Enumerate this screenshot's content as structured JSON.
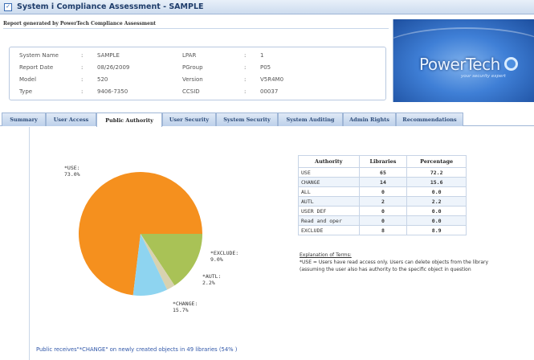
{
  "window": {
    "title": "System i Compliance Assessment - SAMPLE",
    "icon": "checkbox-icon"
  },
  "report_line": "Report generated by PowerTech Compliance Assessment",
  "info": {
    "system_name_label": "System Name",
    "system_name_value": "SAMPLE",
    "report_date_label": "Report Date",
    "report_date_value": "08/26/2009",
    "model_label": "Model",
    "model_value": "520",
    "type_label": "Type",
    "type_value": "9406-7350",
    "lpar_label": "LPAR",
    "lpar_value": "1",
    "pgroup_label": "PGroup",
    "pgroup_value": "P05",
    "version_label": "Version",
    "version_value": "V5R4M0",
    "ccsid_label": "CCSID",
    "ccsid_value": "00037",
    "separator": ":"
  },
  "logo": {
    "word": "PowerTech",
    "tagline": "your security expert"
  },
  "tabs": [
    {
      "label": "Summary"
    },
    {
      "label": "User Access"
    },
    {
      "label": "Public Authority"
    },
    {
      "label": "User Security"
    },
    {
      "label": "System Security"
    },
    {
      "label": "System Auditing"
    },
    {
      "label": "Admin Rights"
    },
    {
      "label": "Recommendations"
    }
  ],
  "active_tab": "Public Authority",
  "chart_data": {
    "type": "pie",
    "slices": [
      {
        "label": "*USE:",
        "value": 73.0,
        "value_text": "73.0%",
        "color": "#f5901e"
      },
      {
        "label": "*CHANGE:",
        "value": 15.7,
        "value_text": "15.7%",
        "color": "#a9c256"
      },
      {
        "label": "*AUTL:",
        "value": 2.2,
        "value_text": "2.2%",
        "color": "#d8d2b0"
      },
      {
        "label": "*EXCLUDE:",
        "value": 9.0,
        "value_text": "9.0%",
        "color": "#8ed4f0"
      }
    ]
  },
  "table": {
    "headers": [
      "Authority",
      "Libraries",
      "Percentage"
    ],
    "rows": [
      {
        "authority": "USE",
        "libraries": "65",
        "percentage": "72.2"
      },
      {
        "authority": "CHANGE",
        "libraries": "14",
        "percentage": "15.6"
      },
      {
        "authority": "ALL",
        "libraries": "0",
        "percentage": "0.0"
      },
      {
        "authority": "AUTL",
        "libraries": "2",
        "percentage": "2.2"
      },
      {
        "authority": "USER DEF",
        "libraries": "0",
        "percentage": "0.0"
      },
      {
        "authority": "Read and oper",
        "libraries": "0",
        "percentage": "0.0"
      },
      {
        "authority": "EXCLUDE",
        "libraries": "8",
        "percentage": "8.9"
      }
    ]
  },
  "terms": {
    "title": "Explanation of Terms:",
    "line1": "*USE = Users have read access only. Users can delete objects from the library",
    "line2": "(assuming the user also has authority to the specific object in question"
  },
  "footer_note": "Public receives\"*CHANGE\" on newly created objects in 49 libraries (54% )"
}
